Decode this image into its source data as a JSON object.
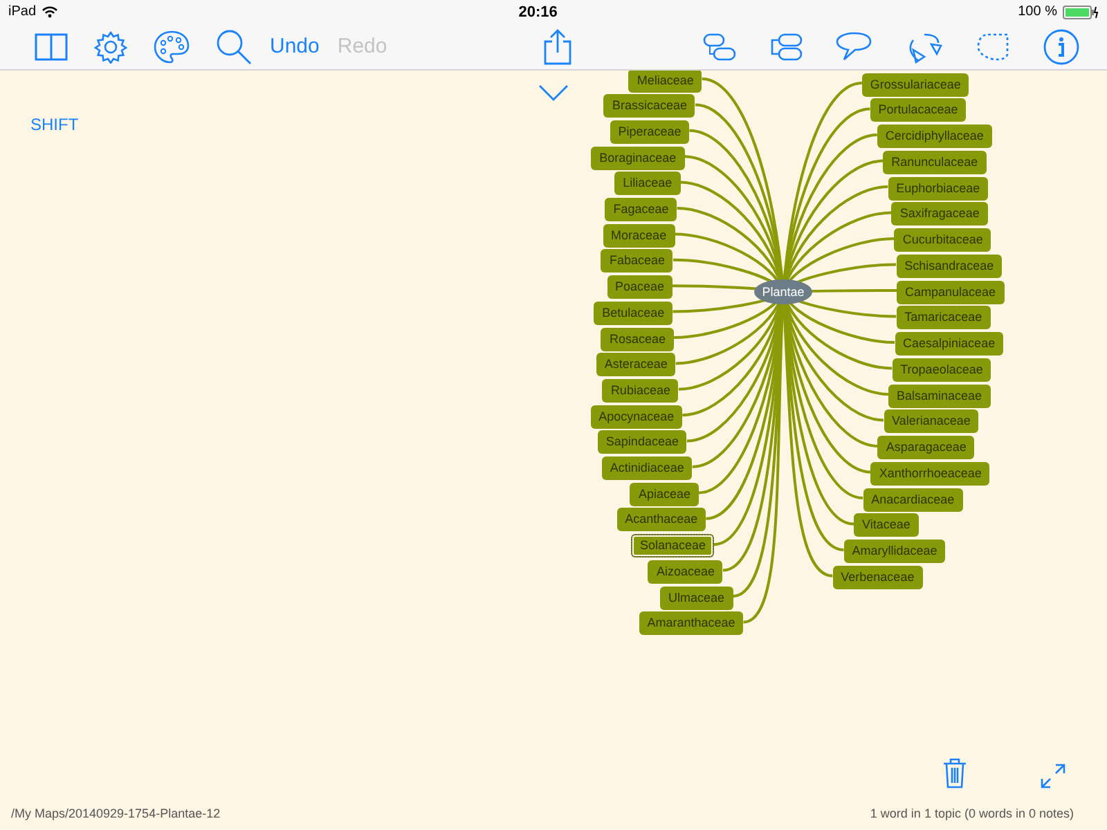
{
  "status_bar": {
    "device": "iPad",
    "time": "20:16",
    "battery": "100 %"
  },
  "toolbar": {
    "undo": "Undo",
    "redo": "Redo",
    "redo_disabled": true
  },
  "shift_label": "SHIFT",
  "map": {
    "root": "Plantae",
    "left": [
      {
        "label": "Meliaceae",
        "selected": false
      },
      {
        "label": "Brassicaceae",
        "selected": false
      },
      {
        "label": "Piperaceae",
        "selected": false
      },
      {
        "label": "Boraginaceae",
        "selected": false
      },
      {
        "label": "Liliaceae",
        "selected": false
      },
      {
        "label": "Fagaceae",
        "selected": false
      },
      {
        "label": "Moraceae",
        "selected": false
      },
      {
        "label": "Fabaceae",
        "selected": false
      },
      {
        "label": "Poaceae",
        "selected": false
      },
      {
        "label": "Betulaceae",
        "selected": false
      },
      {
        "label": "Rosaceae",
        "selected": false
      },
      {
        "label": "Asteraceae",
        "selected": false
      },
      {
        "label": "Rubiaceae",
        "selected": false
      },
      {
        "label": "Apocynaceae",
        "selected": false
      },
      {
        "label": "Sapindaceae",
        "selected": false
      },
      {
        "label": "Actinidiaceae",
        "selected": false
      },
      {
        "label": "Apiaceae",
        "selected": false
      },
      {
        "label": "Acanthaceae",
        "selected": false
      },
      {
        "label": "Solanaceae",
        "selected": true
      },
      {
        "label": "Aizoaceae",
        "selected": false
      },
      {
        "label": "Ulmaceae",
        "selected": false
      },
      {
        "label": "Amaranthaceae",
        "selected": false
      }
    ],
    "right": [
      {
        "label": "Grossulariaceae",
        "selected": false
      },
      {
        "label": "Portulacaceae",
        "selected": false
      },
      {
        "label": "Cercidiphyllaceae",
        "selected": false
      },
      {
        "label": "Ranunculaceae",
        "selected": false
      },
      {
        "label": "Euphorbiaceae",
        "selected": false
      },
      {
        "label": "Saxifragaceae",
        "selected": false
      },
      {
        "label": "Cucurbitaceae",
        "selected": false
      },
      {
        "label": "Schisandraceae",
        "selected": false
      },
      {
        "label": "Campanulaceae",
        "selected": false
      },
      {
        "label": "Tamaricaceae",
        "selected": false
      },
      {
        "label": "Caesalpiniaceae",
        "selected": false
      },
      {
        "label": "Tropaeolaceae",
        "selected": false
      },
      {
        "label": "Balsaminaceae",
        "selected": false
      },
      {
        "label": "Valerianaceae",
        "selected": false
      },
      {
        "label": "Asparagaceae",
        "selected": false
      },
      {
        "label": "Xanthorrhoeaceae",
        "selected": false
      },
      {
        "label": "Anacardiaceae",
        "selected": false
      },
      {
        "label": "Vitaceae",
        "selected": false
      },
      {
        "label": "Amaryllidaceae",
        "selected": false
      },
      {
        "label": "Verbenaceae",
        "selected": false
      }
    ]
  },
  "footer": {
    "path": "/My Maps/20140929-1754-Plantae-12",
    "stats": "1 word in 1 topic (0 words in 0 notes)"
  }
}
